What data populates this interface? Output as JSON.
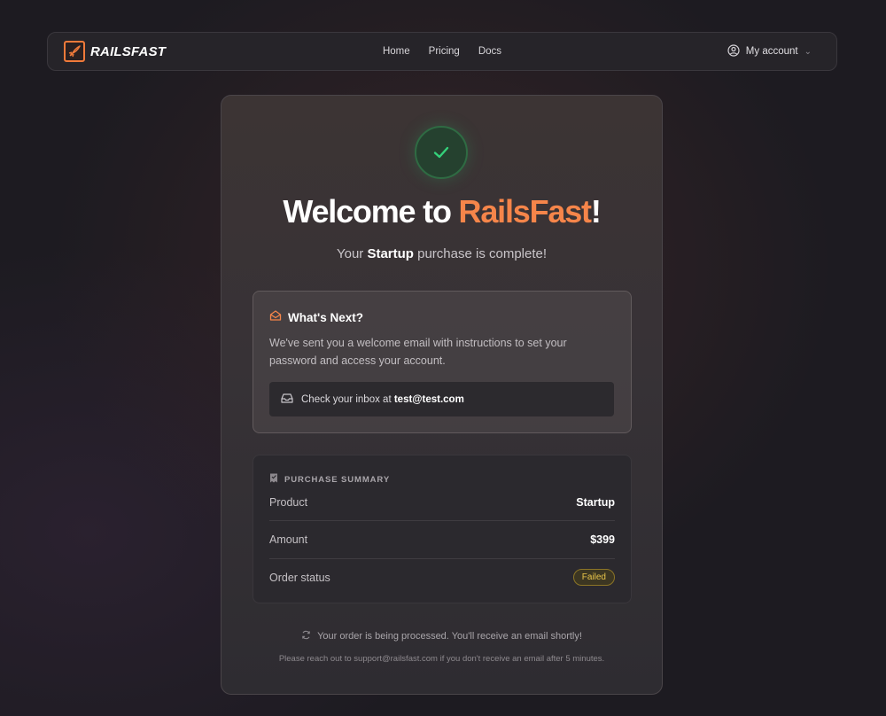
{
  "nav": {
    "logo_text": "RAILSFAST",
    "links": [
      "Home",
      "Pricing",
      "Docs"
    ],
    "account_label": "My account"
  },
  "hero": {
    "title_prefix": "Welcome to ",
    "title_brand": "RailsFast",
    "title_suffix": "!",
    "subtitle_prefix": "Your ",
    "subtitle_plan": "Startup",
    "subtitle_suffix": " purchase is complete!"
  },
  "next": {
    "title": "What's Next?",
    "body": "We've sent you a welcome email with instructions to set your password and access your account.",
    "inbox_prefix": "Check your inbox at ",
    "inbox_email": "test@test.com"
  },
  "summary": {
    "title": "PURCHASE SUMMARY",
    "rows": [
      {
        "label": "Product",
        "value": "Startup"
      },
      {
        "label": "Amount",
        "value": "$399"
      },
      {
        "label": "Order status",
        "value": "Failed"
      }
    ]
  },
  "footer": {
    "processing": "Your order is being processed. You'll receive an email shortly!",
    "support": "Please reach out to support@railsfast.com if you don't receive an email after 5 minutes."
  },
  "colors": {
    "accent": "#f5854a",
    "success": "#34d17a",
    "status_failed": "#e9c54a"
  }
}
